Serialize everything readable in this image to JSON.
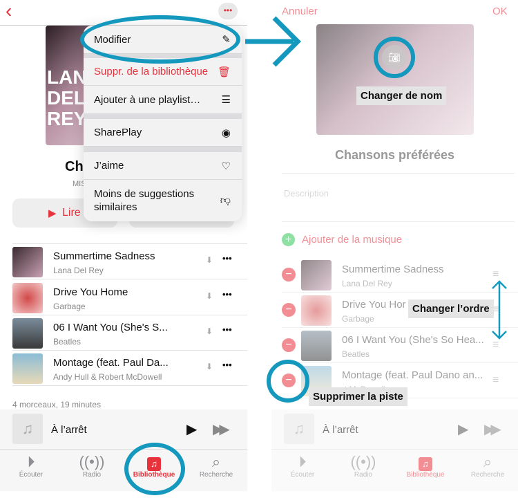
{
  "left": {
    "back_icon": "chevron-left",
    "more_icon": "ellipsis",
    "title_partial": "Cha",
    "subtitle_partial": "MIS",
    "play_label": "Lire",
    "art_text": "LANA DEL REY",
    "menu": [
      {
        "label": "Modifier",
        "icon": "pencil"
      },
      {
        "label": "Suppr. de la bibliothèque",
        "icon": "trash",
        "destructive": true
      },
      {
        "label": "Ajouter à une playlist…",
        "icon": "add-to-list"
      },
      {
        "label": "SharePlay",
        "icon": "shareplay"
      },
      {
        "label": "J’aime",
        "icon": "heart"
      },
      {
        "label": "Moins de suggestions similaires",
        "icon": "thumbs-down"
      }
    ],
    "songs": [
      {
        "title": "Summertime Sadness",
        "artist": "Lana Del Rey"
      },
      {
        "title": "Drive You Home",
        "artist": "Garbage"
      },
      {
        "title": "06 I Want You (She's S...",
        "artist": "Beatles"
      },
      {
        "title": "Montage (feat. Paul Da...",
        "artist": "Andy Hull & Robert McDowell"
      }
    ],
    "summary": "4 morceaux, 19 minutes"
  },
  "right": {
    "cancel": "Annuler",
    "ok": "OK",
    "playlist_name": "Chansons préférées",
    "description_placeholder": "Description",
    "add_music": "Ajouter de la musique",
    "songs": [
      {
        "title": "Summertime Sadness",
        "artist": "Lana Del Rey"
      },
      {
        "title": "Drive You Hor",
        "artist": "Garbage"
      },
      {
        "title": "06 I Want You (She's So Hea...",
        "artist": "Beatles"
      },
      {
        "title": "Montage (feat. Paul Dano an...",
        "artist": "rt McDowell"
      }
    ]
  },
  "player": {
    "status": "À l’arrêt"
  },
  "tabs": [
    {
      "label": "Écouter",
      "icon": "play-circle"
    },
    {
      "label": "Radio",
      "icon": "radio-waves"
    },
    {
      "label": "Bibliothèque",
      "icon": "library-music",
      "active": true
    },
    {
      "label": "Recherche",
      "icon": "magnifier"
    }
  ],
  "annotations": {
    "rename": "Changer de nom",
    "reorder": "Changer l’ordre",
    "delete": "Supprimer la piste"
  },
  "colors": {
    "accent": "#e8333c",
    "annotation": "#1598bd",
    "add": "#34c759"
  }
}
